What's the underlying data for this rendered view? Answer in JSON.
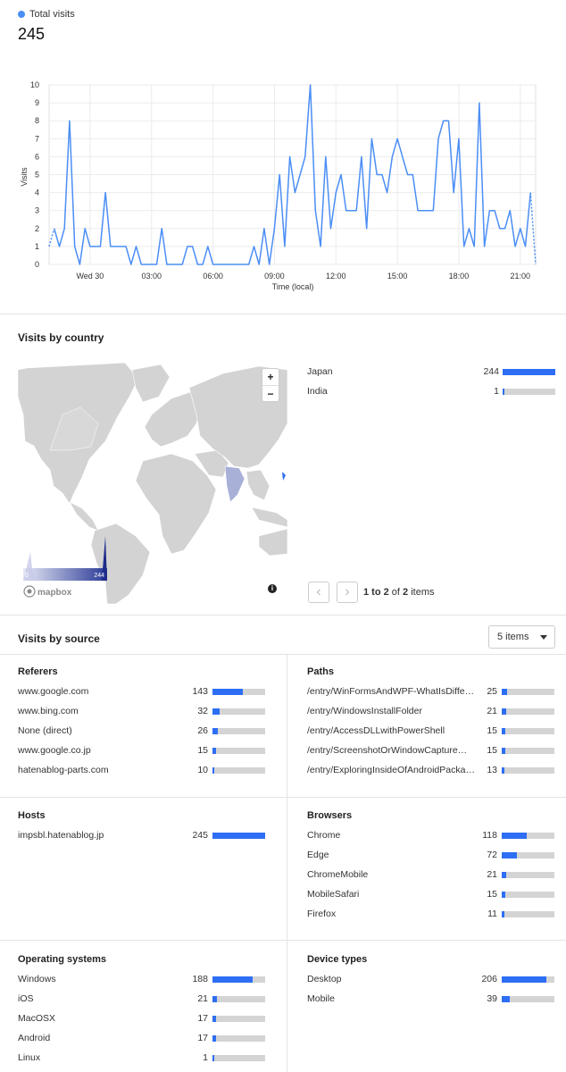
{
  "summary": {
    "legend_label": "Total visits",
    "total": "245",
    "series_color": "#4b8ef5"
  },
  "chart_data": {
    "type": "line",
    "ylabel": "Visits",
    "xlabel": "Time (local)",
    "ylim": [
      0,
      10
    ],
    "yticks": [
      "0",
      "1",
      "2",
      "3",
      "4",
      "5",
      "6",
      "7",
      "8",
      "9",
      "10"
    ],
    "xticks": [
      {
        "label": "Wed 30",
        "i": 8
      },
      {
        "label": "03:00",
        "i": 20
      },
      {
        "label": "06:00",
        "i": 32
      },
      {
        "label": "09:00",
        "i": 44
      },
      {
        "label": "12:00",
        "i": 56
      },
      {
        "label": "15:00",
        "i": 68
      },
      {
        "label": "18:00",
        "i": 80
      },
      {
        "label": "21:00",
        "i": 92
      }
    ],
    "series": [
      {
        "values": [
          1,
          2,
          1,
          2,
          8,
          1,
          0,
          2,
          1,
          1,
          1,
          4,
          1,
          1,
          1,
          1,
          0,
          1,
          0,
          0,
          0,
          0,
          2,
          0,
          0,
          0,
          0,
          1,
          1,
          0,
          0,
          1,
          0,
          0,
          0,
          0,
          0,
          0,
          0,
          0,
          1,
          0,
          2,
          0,
          2,
          5,
          1,
          6,
          4,
          5,
          6,
          10,
          3,
          1,
          6,
          2,
          4,
          5,
          3,
          3,
          3,
          6,
          2,
          7,
          5,
          5,
          4,
          6,
          7,
          6,
          5,
          5,
          3,
          3,
          3,
          3,
          7,
          8,
          8,
          4,
          7,
          1,
          2,
          1,
          9,
          1,
          3,
          3,
          2,
          2,
          3,
          1,
          2,
          1,
          4,
          0
        ],
        "dashed_segments": [
          [
            0,
            1
          ],
          [
            94,
            95
          ]
        ]
      }
    ]
  },
  "country": {
    "title": "Visits by country",
    "items": [
      {
        "name": "Japan",
        "value": "244",
        "frac": 1.0
      },
      {
        "name": "India",
        "value": "1",
        "frac": 0.004
      }
    ],
    "legend_min": "0",
    "legend_max": "244",
    "zoom_in": "+",
    "zoom_out": "−",
    "mapbox": "mapbox",
    "info": "i",
    "pager_prev": "‹",
    "pager_next": "›",
    "pager_range": "1 to 2",
    "pager_of": "of",
    "pager_total": "2",
    "pager_items": "items"
  },
  "source": {
    "title": "Visits by source",
    "select_value": "5 items",
    "referers": {
      "title": "Referers",
      "items": [
        {
          "name": "www.google.com",
          "value": "143",
          "frac": 0.573
        },
        {
          "name": "www.bing.com",
          "value": "32",
          "frac": 0.128
        },
        {
          "name": "None (direct)",
          "value": "26",
          "frac": 0.104
        },
        {
          "name": "www.google.co.jp",
          "value": "15",
          "frac": 0.06
        },
        {
          "name": "hatenablog-parts.com",
          "value": "10",
          "frac": 0.04
        }
      ]
    },
    "paths": {
      "title": "Paths",
      "items": [
        {
          "name": "/entry/WinFormsAndWPF-WhatIsDiffer...",
          "value": "25",
          "frac": 0.1
        },
        {
          "name": "/entry/WindowsInstallFolder",
          "value": "21",
          "frac": 0.086
        },
        {
          "name": "/entry/AccessDLLwithPowerShell",
          "value": "15",
          "frac": 0.06
        },
        {
          "name": "/entry/ScreenshotOrWindowCaptureWi...",
          "value": "15",
          "frac": 0.06
        },
        {
          "name": "/entry/ExploringInsideOfAndroidPackage",
          "value": "13",
          "frac": 0.053
        }
      ]
    },
    "hosts": {
      "title": "Hosts",
      "items": [
        {
          "name": "impsbl.hatenablog.jp",
          "value": "245",
          "frac": 1.0
        }
      ]
    },
    "browsers": {
      "title": "Browsers",
      "items": [
        {
          "name": "Chrome",
          "value": "118",
          "frac": 0.48
        },
        {
          "name": "Edge",
          "value": "72",
          "frac": 0.294
        },
        {
          "name": "ChromeMobile",
          "value": "21",
          "frac": 0.086
        },
        {
          "name": "MobileSafari",
          "value": "15",
          "frac": 0.06
        },
        {
          "name": "Firefox",
          "value": "11",
          "frac": 0.045
        }
      ]
    },
    "os": {
      "title": "Operating systems",
      "items": [
        {
          "name": "Windows",
          "value": "188",
          "frac": 0.767
        },
        {
          "name": "iOS",
          "value": "21",
          "frac": 0.086
        },
        {
          "name": "MacOSX",
          "value": "17",
          "frac": 0.07
        },
        {
          "name": "Android",
          "value": "17",
          "frac": 0.07
        },
        {
          "name": "Linux",
          "value": "1",
          "frac": 0.004
        }
      ]
    },
    "devices": {
      "title": "Device types",
      "items": [
        {
          "name": "Desktop",
          "value": "206",
          "frac": 0.84
        },
        {
          "name": "Mobile",
          "value": "39",
          "frac": 0.16
        }
      ]
    }
  }
}
